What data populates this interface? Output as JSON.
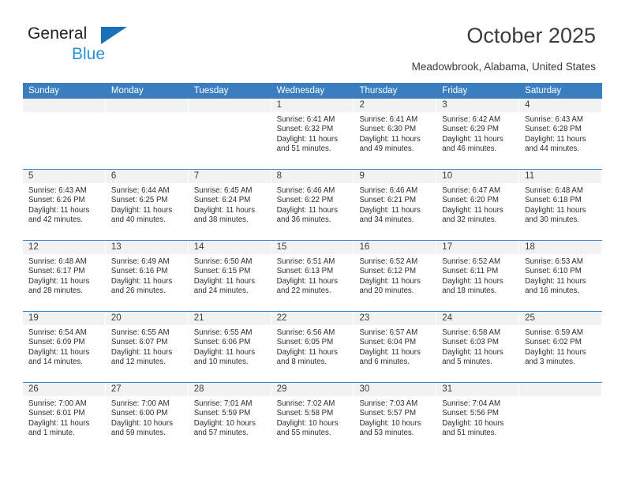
{
  "logo": {
    "word1": "General",
    "word2": "Blue",
    "triangle_color": "#1972b8",
    "blue_text_color": "#2a90d6"
  },
  "header": {
    "title": "October 2025",
    "subtitle": "Meadowbrook, Alabama, United States",
    "accent_color": "#3a7ebf",
    "day_strip_color": "#f2f2f2"
  },
  "weekday_headers": [
    "Sunday",
    "Monday",
    "Tuesday",
    "Wednesday",
    "Thursday",
    "Friday",
    "Saturday"
  ],
  "labels": {
    "sunrise": "Sunrise:",
    "sunset": "Sunset:",
    "daylight": "Daylight:"
  },
  "weeks": [
    [
      {
        "day": "",
        "empty": true
      },
      {
        "day": "",
        "empty": true
      },
      {
        "day": "",
        "empty": true
      },
      {
        "day": "1",
        "sunrise": "Sunrise: 6:41 AM",
        "sunset": "Sunset: 6:32 PM",
        "daylight1": "Daylight: 11 hours",
        "daylight2": "and 51 minutes."
      },
      {
        "day": "2",
        "sunrise": "Sunrise: 6:41 AM",
        "sunset": "Sunset: 6:30 PM",
        "daylight1": "Daylight: 11 hours",
        "daylight2": "and 49 minutes."
      },
      {
        "day": "3",
        "sunrise": "Sunrise: 6:42 AM",
        "sunset": "Sunset: 6:29 PM",
        "daylight1": "Daylight: 11 hours",
        "daylight2": "and 46 minutes."
      },
      {
        "day": "4",
        "sunrise": "Sunrise: 6:43 AM",
        "sunset": "Sunset: 6:28 PM",
        "daylight1": "Daylight: 11 hours",
        "daylight2": "and 44 minutes."
      }
    ],
    [
      {
        "day": "5",
        "sunrise": "Sunrise: 6:43 AM",
        "sunset": "Sunset: 6:26 PM",
        "daylight1": "Daylight: 11 hours",
        "daylight2": "and 42 minutes."
      },
      {
        "day": "6",
        "sunrise": "Sunrise: 6:44 AM",
        "sunset": "Sunset: 6:25 PM",
        "daylight1": "Daylight: 11 hours",
        "daylight2": "and 40 minutes."
      },
      {
        "day": "7",
        "sunrise": "Sunrise: 6:45 AM",
        "sunset": "Sunset: 6:24 PM",
        "daylight1": "Daylight: 11 hours",
        "daylight2": "and 38 minutes."
      },
      {
        "day": "8",
        "sunrise": "Sunrise: 6:46 AM",
        "sunset": "Sunset: 6:22 PM",
        "daylight1": "Daylight: 11 hours",
        "daylight2": "and 36 minutes."
      },
      {
        "day": "9",
        "sunrise": "Sunrise: 6:46 AM",
        "sunset": "Sunset: 6:21 PM",
        "daylight1": "Daylight: 11 hours",
        "daylight2": "and 34 minutes."
      },
      {
        "day": "10",
        "sunrise": "Sunrise: 6:47 AM",
        "sunset": "Sunset: 6:20 PM",
        "daylight1": "Daylight: 11 hours",
        "daylight2": "and 32 minutes."
      },
      {
        "day": "11",
        "sunrise": "Sunrise: 6:48 AM",
        "sunset": "Sunset: 6:18 PM",
        "daylight1": "Daylight: 11 hours",
        "daylight2": "and 30 minutes."
      }
    ],
    [
      {
        "day": "12",
        "sunrise": "Sunrise: 6:48 AM",
        "sunset": "Sunset: 6:17 PM",
        "daylight1": "Daylight: 11 hours",
        "daylight2": "and 28 minutes."
      },
      {
        "day": "13",
        "sunrise": "Sunrise: 6:49 AM",
        "sunset": "Sunset: 6:16 PM",
        "daylight1": "Daylight: 11 hours",
        "daylight2": "and 26 minutes."
      },
      {
        "day": "14",
        "sunrise": "Sunrise: 6:50 AM",
        "sunset": "Sunset: 6:15 PM",
        "daylight1": "Daylight: 11 hours",
        "daylight2": "and 24 minutes."
      },
      {
        "day": "15",
        "sunrise": "Sunrise: 6:51 AM",
        "sunset": "Sunset: 6:13 PM",
        "daylight1": "Daylight: 11 hours",
        "daylight2": "and 22 minutes."
      },
      {
        "day": "16",
        "sunrise": "Sunrise: 6:52 AM",
        "sunset": "Sunset: 6:12 PM",
        "daylight1": "Daylight: 11 hours",
        "daylight2": "and 20 minutes."
      },
      {
        "day": "17",
        "sunrise": "Sunrise: 6:52 AM",
        "sunset": "Sunset: 6:11 PM",
        "daylight1": "Daylight: 11 hours",
        "daylight2": "and 18 minutes."
      },
      {
        "day": "18",
        "sunrise": "Sunrise: 6:53 AM",
        "sunset": "Sunset: 6:10 PM",
        "daylight1": "Daylight: 11 hours",
        "daylight2": "and 16 minutes."
      }
    ],
    [
      {
        "day": "19",
        "sunrise": "Sunrise: 6:54 AM",
        "sunset": "Sunset: 6:09 PM",
        "daylight1": "Daylight: 11 hours",
        "daylight2": "and 14 minutes."
      },
      {
        "day": "20",
        "sunrise": "Sunrise: 6:55 AM",
        "sunset": "Sunset: 6:07 PM",
        "daylight1": "Daylight: 11 hours",
        "daylight2": "and 12 minutes."
      },
      {
        "day": "21",
        "sunrise": "Sunrise: 6:55 AM",
        "sunset": "Sunset: 6:06 PM",
        "daylight1": "Daylight: 11 hours",
        "daylight2": "and 10 minutes."
      },
      {
        "day": "22",
        "sunrise": "Sunrise: 6:56 AM",
        "sunset": "Sunset: 6:05 PM",
        "daylight1": "Daylight: 11 hours",
        "daylight2": "and 8 minutes."
      },
      {
        "day": "23",
        "sunrise": "Sunrise: 6:57 AM",
        "sunset": "Sunset: 6:04 PM",
        "daylight1": "Daylight: 11 hours",
        "daylight2": "and 6 minutes."
      },
      {
        "day": "24",
        "sunrise": "Sunrise: 6:58 AM",
        "sunset": "Sunset: 6:03 PM",
        "daylight1": "Daylight: 11 hours",
        "daylight2": "and 5 minutes."
      },
      {
        "day": "25",
        "sunrise": "Sunrise: 6:59 AM",
        "sunset": "Sunset: 6:02 PM",
        "daylight1": "Daylight: 11 hours",
        "daylight2": "and 3 minutes."
      }
    ],
    [
      {
        "day": "26",
        "sunrise": "Sunrise: 7:00 AM",
        "sunset": "Sunset: 6:01 PM",
        "daylight1": "Daylight: 11 hours",
        "daylight2": "and 1 minute."
      },
      {
        "day": "27",
        "sunrise": "Sunrise: 7:00 AM",
        "sunset": "Sunset: 6:00 PM",
        "daylight1": "Daylight: 10 hours",
        "daylight2": "and 59 minutes."
      },
      {
        "day": "28",
        "sunrise": "Sunrise: 7:01 AM",
        "sunset": "Sunset: 5:59 PM",
        "daylight1": "Daylight: 10 hours",
        "daylight2": "and 57 minutes."
      },
      {
        "day": "29",
        "sunrise": "Sunrise: 7:02 AM",
        "sunset": "Sunset: 5:58 PM",
        "daylight1": "Daylight: 10 hours",
        "daylight2": "and 55 minutes."
      },
      {
        "day": "30",
        "sunrise": "Sunrise: 7:03 AM",
        "sunset": "Sunset: 5:57 PM",
        "daylight1": "Daylight: 10 hours",
        "daylight2": "and 53 minutes."
      },
      {
        "day": "31",
        "sunrise": "Sunrise: 7:04 AM",
        "sunset": "Sunset: 5:56 PM",
        "daylight1": "Daylight: 10 hours",
        "daylight2": "and 51 minutes."
      },
      {
        "day": "",
        "empty": true
      }
    ]
  ]
}
